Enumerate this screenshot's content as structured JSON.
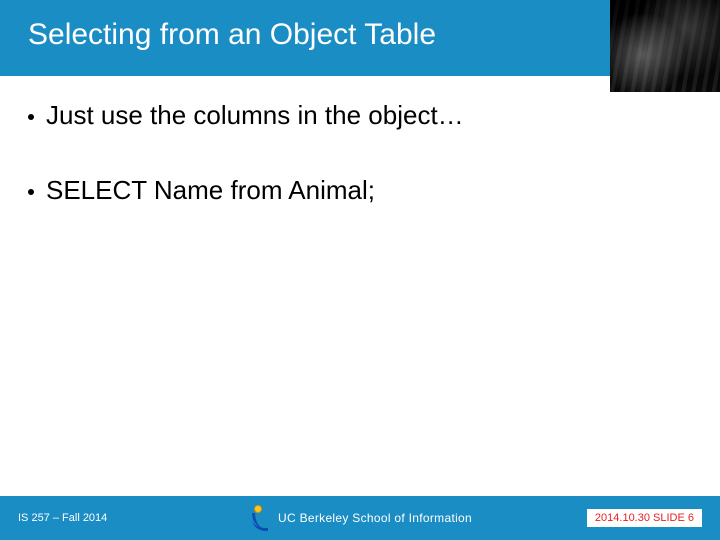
{
  "title": "Selecting from an Object Table",
  "bullets": [
    "Just use the columns in the object…",
    "SELECT  Name from Animal;"
  ],
  "footer": {
    "course": "IS 257 – Fall 2014",
    "brand": "UC Berkeley School of Information",
    "date_slide": "2014.10.30 SLIDE 6"
  }
}
